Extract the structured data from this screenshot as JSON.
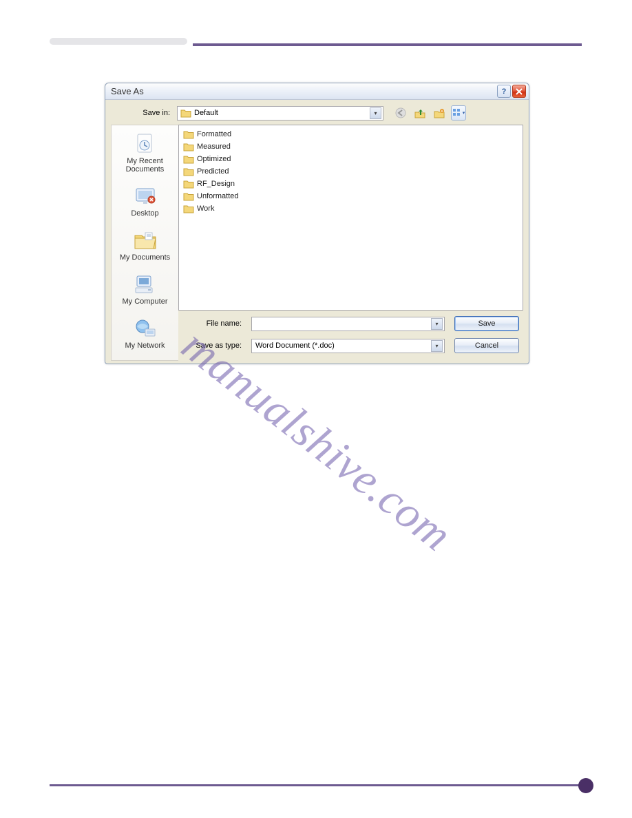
{
  "dialog": {
    "title": "Save As",
    "savein_label": "Save in:",
    "savein_value": "Default",
    "filename_label": "File name:",
    "filename_value": "",
    "savetype_label": "Save as type:",
    "savetype_value": "Word Document (*.doc)",
    "save_button": "Save",
    "cancel_button": "Cancel"
  },
  "places": [
    {
      "label": "My Recent Documents"
    },
    {
      "label": "Desktop"
    },
    {
      "label": "My Documents"
    },
    {
      "label": "My Computer"
    },
    {
      "label": "My Network"
    }
  ],
  "folders": [
    "Formatted",
    "Measured",
    "Optimized",
    "Predicted",
    "RF_Design",
    "Unformatted",
    "Work"
  ],
  "watermark": "manualshive.com"
}
